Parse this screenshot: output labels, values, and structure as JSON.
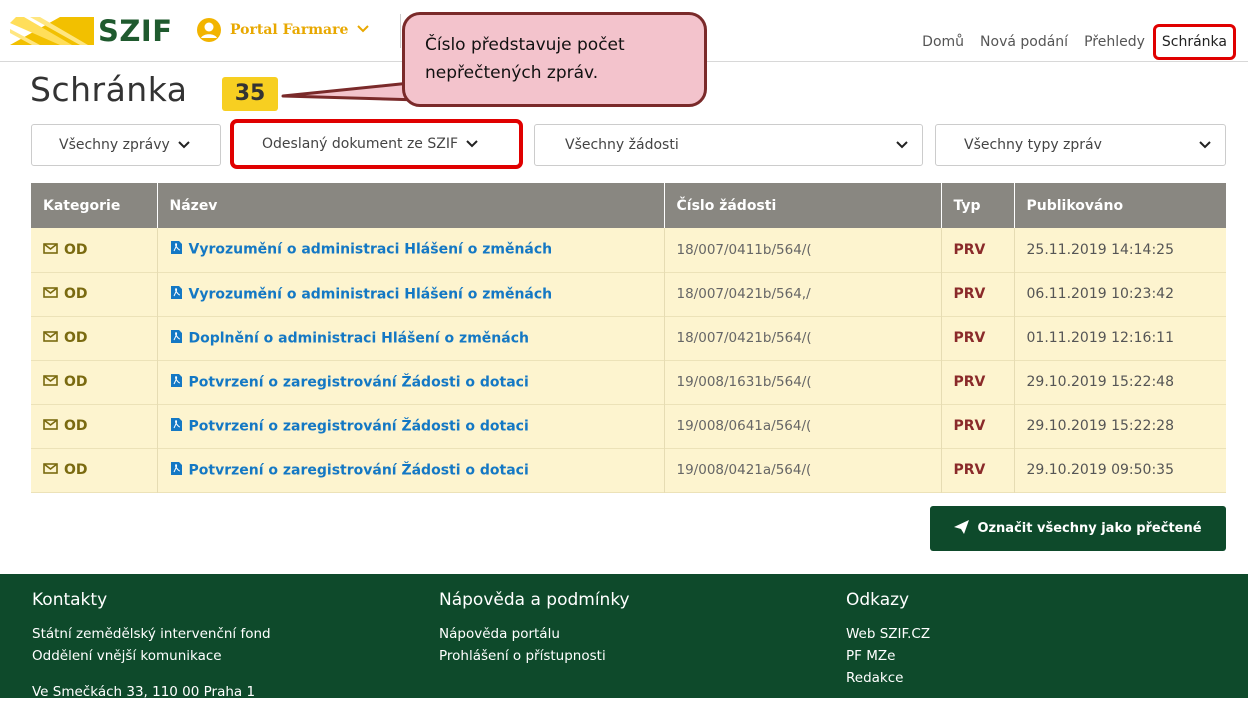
{
  "header": {
    "logo_text": "SZIF",
    "portal_label": "Portal Farmare",
    "nav": [
      "Domů",
      "Nová podání",
      "Přehledy"
    ],
    "nav_active": "Schránka"
  },
  "callout": {
    "line1": "Číslo představuje počet",
    "line2": "nepřečtených zpráv."
  },
  "page": {
    "title": "Schránka",
    "unread_count": "35"
  },
  "filters": {
    "messages": "Všechny zprávy",
    "source": "Odeslaný dokument ze SZIF",
    "requests": "Všechny žádosti",
    "types": "Všechny typy zpráv"
  },
  "table": {
    "headers": [
      "Kategorie",
      "Název",
      "Číslo žádosti",
      "Typ",
      "Publikováno"
    ],
    "rows": [
      {
        "cat": "OD",
        "name": "Vyrozumění o administraci Hlášení o změnách",
        "num": "18/007/0411b/564/(",
        "typ": "PRV",
        "pub": "25.11.2019 14:14:25"
      },
      {
        "cat": "OD",
        "name": "Vyrozumění o administraci Hlášení o změnách",
        "num": "18/007/0421b/564,/",
        "typ": "PRV",
        "pub": "06.11.2019 10:23:42"
      },
      {
        "cat": "OD",
        "name": "Doplnění o administraci Hlášení o změnách",
        "num": "18/007/0421b/564/(",
        "typ": "PRV",
        "pub": "01.11.2019 12:16:11"
      },
      {
        "cat": "OD",
        "name": "Potvrzení o zaregistrování Žádosti o dotaci",
        "num": "19/008/1631b/564/(",
        "typ": "PRV",
        "pub": "29.10.2019 15:22:48"
      },
      {
        "cat": "OD",
        "name": "Potvrzení o zaregistrování Žádosti o dotaci",
        "num": "19/008/0641a/564/(",
        "typ": "PRV",
        "pub": "29.10.2019 15:22:28"
      },
      {
        "cat": "OD",
        "name": "Potvrzení o zaregistrování Žádosti o dotaci",
        "num": "19/008/0421a/564/(",
        "typ": "PRV",
        "pub": "29.10.2019 09:50:35"
      }
    ]
  },
  "actions": {
    "mark_all": "Označit všechny jako přečtené"
  },
  "footer": {
    "contacts_title": "Kontakty",
    "contacts": [
      "Státní zemědělský intervenční fond",
      "Oddělení vnější komunikace"
    ],
    "address": "Ve Smečkách 33, 110 00 Praha 1",
    "help_title": "Nápověda a podmínky",
    "help": [
      "Nápověda portálu",
      "Prohlášení o přístupnosti"
    ],
    "links_title": "Odkazy",
    "links": [
      "Web SZIF.CZ",
      "PF MZe",
      "Redakce"
    ]
  },
  "colors": {
    "brand_green": "#0e4a2b",
    "accent_yellow": "#f7cf21",
    "highlight_red": "#e00000",
    "link_blue": "#1478c4"
  }
}
